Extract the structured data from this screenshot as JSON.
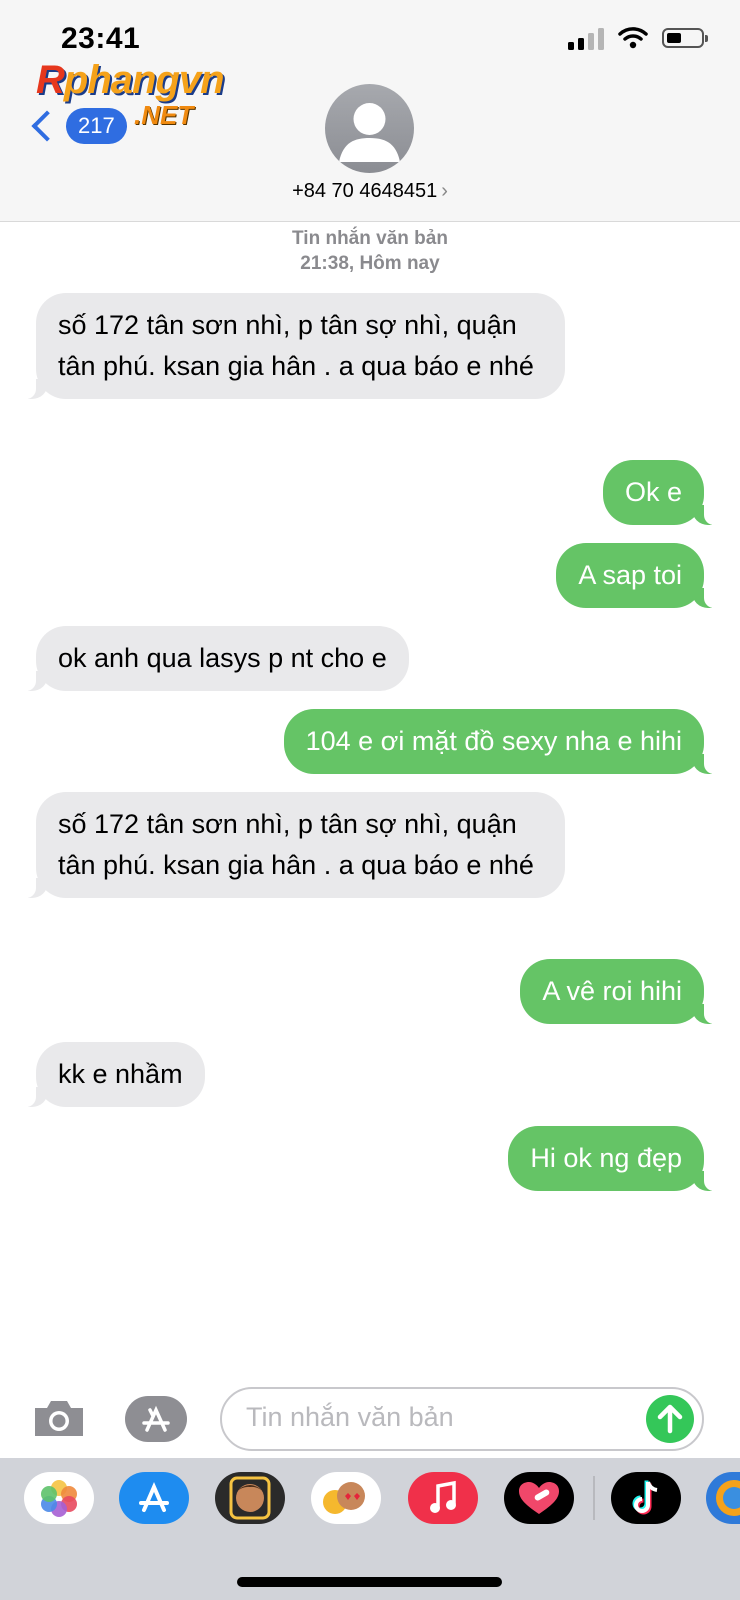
{
  "status_bar": {
    "time": "23:41"
  },
  "watermark": {
    "main_first": "R",
    "main_rest": "phangvn",
    "suffix": ".NET"
  },
  "nav": {
    "back_count": "217",
    "contact": "+84 70 4648451"
  },
  "thread": {
    "meta_type": "Tin nhắn văn bản",
    "meta_time": "21:38, Hôm nay",
    "messages": [
      {
        "dir": "in",
        "text": "số 172 tân sơn nhì, p tân sợ nhì, quận tân phú. ksan gia hân . a qua báo e nhé"
      },
      {
        "dir": "out",
        "text": "Ok e"
      },
      {
        "dir": "out",
        "text": "A sap toi"
      },
      {
        "dir": "in",
        "text": "ok anh qua lasys p nt cho e"
      },
      {
        "dir": "out",
        "text": "104 e ơi mặt đồ sexy nha e hihi"
      },
      {
        "dir": "in",
        "text": "số 172 tân sơn nhì, p tân sợ nhì, quận tân phú. ksan gia hân . a qua báo e nhé"
      },
      {
        "dir": "out",
        "text": "A vê roi hihi"
      },
      {
        "dir": "in",
        "text": "kk e nhầm"
      },
      {
        "dir": "out",
        "text": "Hi ok ng đẹp"
      }
    ]
  },
  "composer": {
    "placeholder": "Tin nhắn văn bản"
  },
  "app_tray": [
    "photos-icon",
    "app-store-icon",
    "memoji-icon",
    "animoji-icon",
    "music-icon",
    "heart-app-icon",
    "tiktok-icon",
    "globe-app-icon"
  ],
  "colors": {
    "incoming": "#e9e9eb",
    "outgoing": "#65c466",
    "accent": "#2f6de1",
    "send": "#34c759"
  }
}
